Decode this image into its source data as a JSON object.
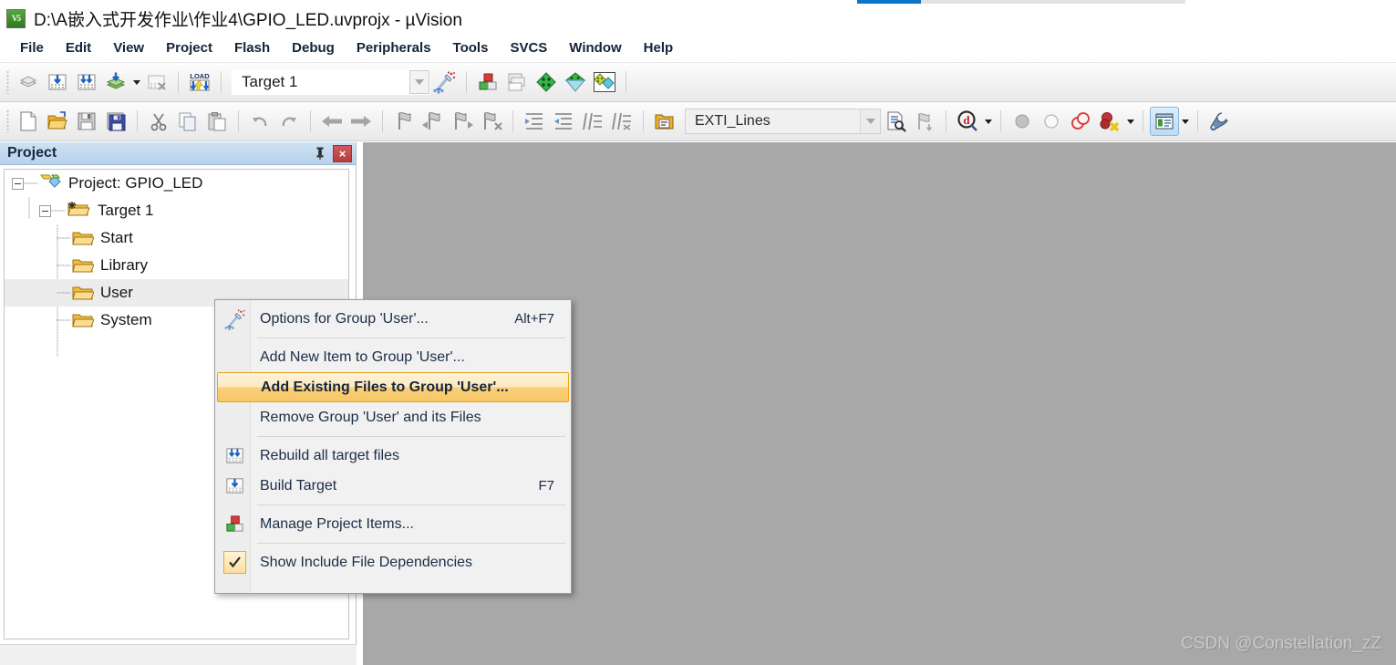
{
  "window": {
    "title": "D:\\A嵌入式开发作业\\作业4\\GPIO_LED.uvprojx - µVision",
    "app_icon": "uvision-icon",
    "icon_text": "V5"
  },
  "progress": {
    "value_pct": 19
  },
  "menubar": {
    "items": [
      {
        "label": "File"
      },
      {
        "label": "Edit"
      },
      {
        "label": "View"
      },
      {
        "label": "Project"
      },
      {
        "label": "Flash"
      },
      {
        "label": "Debug"
      },
      {
        "label": "Peripherals"
      },
      {
        "label": "Tools"
      },
      {
        "label": "SVCS"
      },
      {
        "label": "Window"
      },
      {
        "label": "Help"
      }
    ]
  },
  "toolbar_build": {
    "buttons": [
      {
        "name": "translate-icon",
        "title": "Translate"
      },
      {
        "name": "build-icon",
        "title": "Build"
      },
      {
        "name": "rebuild-icon",
        "title": "Rebuild"
      },
      {
        "name": "batch-build-icon",
        "title": "Batch Build"
      },
      {
        "name": "stop-build-icon",
        "title": "Stop Build"
      },
      {
        "name": "download-icon",
        "title": "Download",
        "badge": "LOAD"
      }
    ],
    "target_select": {
      "value": "Target 1",
      "placeholder": "Target 1"
    },
    "right_buttons": [
      {
        "name": "target-options-icon",
        "title": "Options for Target"
      },
      {
        "name": "manage-project-items-icon",
        "title": "Manage Project Items"
      },
      {
        "name": "multi-project-icon",
        "title": "Multi-Project"
      },
      {
        "name": "pack-installer-icon",
        "title": "Pack Installer"
      },
      {
        "name": "run-time-env-icon",
        "title": "Manage Run-Time Environment"
      },
      {
        "name": "pack-manage-icon",
        "title": "Manage Packs"
      }
    ]
  },
  "toolbar_file": {
    "buttons": [
      {
        "name": "new-file-icon",
        "title": "New"
      },
      {
        "name": "open-file-icon",
        "title": "Open"
      },
      {
        "name": "save-icon",
        "title": "Save"
      },
      {
        "name": "save-all-icon",
        "title": "Save All"
      },
      {
        "name": "cut-icon",
        "title": "Cut"
      },
      {
        "name": "copy-icon",
        "title": "Copy"
      },
      {
        "name": "paste-icon",
        "title": "Paste"
      },
      {
        "name": "undo-icon",
        "title": "Undo"
      },
      {
        "name": "redo-icon",
        "title": "Redo"
      },
      {
        "name": "back-icon",
        "title": "Navigate Backwards"
      },
      {
        "name": "forward-icon",
        "title": "Navigate Forwards"
      },
      {
        "name": "bookmark-toggle-icon",
        "title": "Insert/Remove Bookmark"
      },
      {
        "name": "bookmark-prev-icon",
        "title": "Previous Bookmark"
      },
      {
        "name": "bookmark-next-icon",
        "title": "Next Bookmark"
      },
      {
        "name": "bookmark-clear-icon",
        "title": "Clear All Bookmarks"
      },
      {
        "name": "indent-icon",
        "title": "Indent"
      },
      {
        "name": "outdent-icon",
        "title": "Outdent"
      },
      {
        "name": "comment-icon",
        "title": "Comment"
      },
      {
        "name": "uncomment-icon",
        "title": "Uncomment"
      },
      {
        "name": "open-folder-icon",
        "title": "Open Project Folder"
      }
    ],
    "search_select": {
      "value": "EXTI_Lines"
    },
    "right_buttons": [
      {
        "name": "find-in-files-icon",
        "title": "Find in Files"
      },
      {
        "name": "incremental-find-icon",
        "title": "Incremental Find"
      },
      {
        "name": "start-debug-icon",
        "title": "Start/Stop Debug Session"
      },
      {
        "name": "insert-breakpoint-icon",
        "title": "Insert/Remove Breakpoint"
      },
      {
        "name": "enable-breakpoint-icon",
        "title": "Enable/Disable Breakpoint"
      },
      {
        "name": "disable-all-breakpoints-icon",
        "title": "Disable All Breakpoints"
      },
      {
        "name": "kill-all-breakpoints-icon",
        "title": "Kill All Breakpoints"
      },
      {
        "name": "project-window-icon",
        "title": "Project Window"
      },
      {
        "name": "configuration-icon",
        "title": "Configuration"
      }
    ]
  },
  "project_panel": {
    "title": "Project",
    "pin_icon": "pin-icon",
    "close_icon": "close-icon",
    "tree": [
      {
        "label": "Project: GPIO_LED",
        "icon": "project-icon",
        "level": 0,
        "expandable": true,
        "selected": false
      },
      {
        "label": "Target 1",
        "icon": "target-icon",
        "level": 1,
        "expandable": true,
        "selected": false
      },
      {
        "label": "Start",
        "icon": "folder-icon",
        "level": 2,
        "expandable": false,
        "selected": false
      },
      {
        "label": "Library",
        "icon": "folder-icon",
        "level": 2,
        "expandable": false,
        "selected": false
      },
      {
        "label": "User",
        "icon": "folder-icon",
        "level": 2,
        "expandable": false,
        "selected": true
      },
      {
        "label": "System",
        "icon": "folder-icon",
        "level": 2,
        "expandable": false,
        "selected": false
      }
    ]
  },
  "context_menu": {
    "items": [
      {
        "type": "item",
        "label": "Options for Group 'User'...",
        "accel": "Alt+F7",
        "icon": "magic-wand-icon",
        "highlight": false
      },
      {
        "type": "separator"
      },
      {
        "type": "item",
        "label": "Add New  Item to Group 'User'...",
        "accel": "",
        "icon": "",
        "highlight": false
      },
      {
        "type": "item",
        "label": "Add Existing Files to Group 'User'...",
        "accel": "",
        "icon": "",
        "highlight": true
      },
      {
        "type": "item",
        "label": "Remove Group 'User' and its Files",
        "accel": "",
        "icon": "",
        "highlight": false
      },
      {
        "type": "separator"
      },
      {
        "type": "item",
        "label": "Rebuild all target files",
        "accel": "",
        "icon": "rebuild-icon",
        "highlight": false
      },
      {
        "type": "item",
        "label": "Build Target",
        "accel": "F7",
        "icon": "build-icon",
        "highlight": false
      },
      {
        "type": "separator"
      },
      {
        "type": "item",
        "label": "Manage Project Items...",
        "accel": "",
        "icon": "manage-project-items-icon",
        "highlight": false
      },
      {
        "type": "separator"
      },
      {
        "type": "item",
        "label": "Show Include File Dependencies",
        "accel": "",
        "icon": "checkmark-icon",
        "highlight": false,
        "checked": true
      }
    ]
  },
  "editor": {
    "watermark": "CSDN @Constellation_zZ"
  },
  "colors": {
    "accent_blue": "#0a74c8",
    "panel_header": "#b6d2ea",
    "highlight_orange": "#e8a317",
    "editor_bg": "#a8a8a8",
    "close_red": "#b73e3e"
  }
}
